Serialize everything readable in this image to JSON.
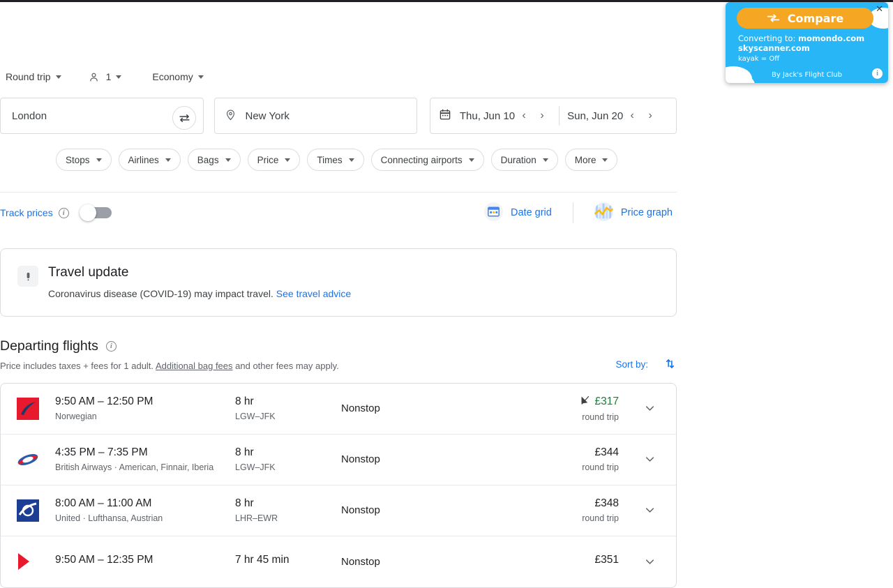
{
  "options": {
    "trip_type": "Round trip",
    "passengers": "1",
    "cabin": "Economy"
  },
  "search": {
    "origin": "London",
    "destination": "New York",
    "depart_date": "Thu, Jun 10",
    "return_date": "Sun, Jun 20",
    "prev_arrow": "‹",
    "next_arrow": "›"
  },
  "filters": [
    {
      "label": "Stops"
    },
    {
      "label": "Airlines"
    },
    {
      "label": "Bags"
    },
    {
      "label": "Price"
    },
    {
      "label": "Times"
    },
    {
      "label": "Connecting airports"
    },
    {
      "label": "Duration"
    },
    {
      "label": "More"
    }
  ],
  "tools": {
    "track_prices_label": "Track prices",
    "track_prices_on": false,
    "date_grid_label": "Date grid",
    "price_graph_label": "Price graph",
    "info_glyph": "i"
  },
  "travel_update": {
    "title": "Travel update",
    "text_before": "Coronavirus disease (COVID-19) may impact travel. ",
    "link": "See travel advice"
  },
  "departing": {
    "heading": "Departing flights",
    "note_before": "Price includes taxes + fees for 1 adult. ",
    "note_link": "Additional bag fees",
    "note_after": " and other fees may apply.",
    "sort_label": "Sort by:"
  },
  "flights": [
    {
      "times": "9:50 AM – 12:50 PM",
      "airlines": "Norwegian",
      "duration": "8 hr",
      "route": "LGW–JFK",
      "stops": "Nonstop",
      "price": "£317",
      "price_note": "round trip",
      "price_highlight": true,
      "has_price_tag_icon": true,
      "logo_color": "#e8192c"
    },
    {
      "times": "4:35 PM – 7:35 PM",
      "airlines": "British Airways · American, Finnair, Iberia",
      "duration": "8 hr",
      "route": "LGW–JFK",
      "stops": "Nonstop",
      "price": "£344",
      "price_note": "round trip",
      "price_highlight": false,
      "has_price_tag_icon": false,
      "logo_color": "#2a5caa"
    },
    {
      "times": "8:00 AM – 11:00 AM",
      "airlines": "United · Lufthansa, Austrian",
      "duration": "8 hr",
      "route": "LHR–EWR",
      "stops": "Nonstop",
      "price": "£348",
      "price_note": "round trip",
      "price_highlight": false,
      "has_price_tag_icon": false,
      "logo_color": "#1c3f94"
    },
    {
      "times": "9:50 AM – 12:35 PM",
      "airlines": "",
      "duration": "7 hr 45 min",
      "route": "",
      "stops": "Nonstop",
      "price": "£351",
      "price_note": "",
      "price_highlight": false,
      "has_price_tag_icon": false,
      "logo_color": "#e8192c"
    }
  ],
  "extension": {
    "button_label": "Compare",
    "converting_prefix": "Converting to: ",
    "site1": "momondo.com",
    "site2": "skyscanner.com",
    "kayak_status": "kayak = Off",
    "footer": "By Jack's Flight Club",
    "close_glyph": "✕",
    "info_glyph": "i",
    "accent_color": "#29b6f6",
    "button_color": "#f5a623"
  }
}
